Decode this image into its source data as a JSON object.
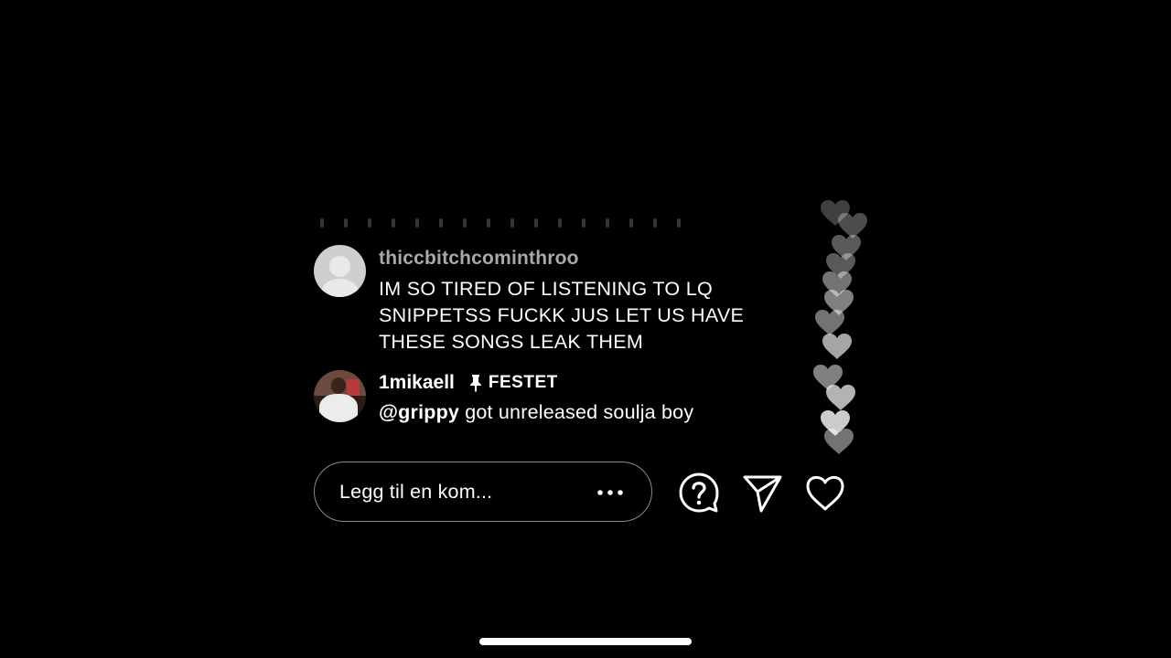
{
  "comments": [
    {
      "username": "thiccbitchcominthroo",
      "text": "IM SO TIRED OF LISTENING TO LQ SNIPPETSS FUCKK JUS LET US HAVE THESE SONGS LEAK THEM",
      "lines": [
        "IM SO TIRED OF LISTENING TO LQ",
        "SNIPPETSS FUCKK JUS LET US HAVE",
        "THESE SONGS LEAK THEM"
      ],
      "avatar_icon": "default-avatar-icon"
    },
    {
      "username": "1mikaell",
      "pinned_label": "FESTET",
      "mention": "@grippy",
      "text": " got unreleased soulja boy",
      "avatar_icon": "user-photo"
    }
  ],
  "composer": {
    "placeholder": "Legg til en kom...",
    "more_icon": "more-dots-icon"
  },
  "actions": {
    "question_icon": "question-icon",
    "send_icon": "send-icon",
    "like_icon": "heart-icon"
  },
  "colors": {
    "background": "#000000",
    "text": "#ffffff",
    "muted_username": "#a9a9a9",
    "pill_border": "#8a8a8a"
  }
}
